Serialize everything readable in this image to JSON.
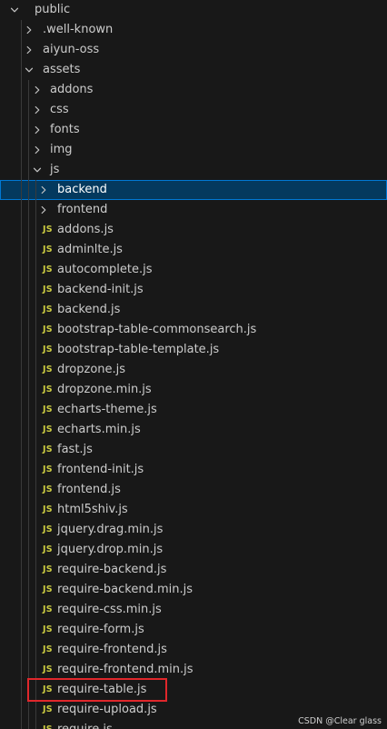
{
  "tree": [
    {
      "label": "public",
      "type": "folder",
      "depth": 0,
      "expanded": true
    },
    {
      "label": ".well-known",
      "type": "folder",
      "depth": 1,
      "expanded": false
    },
    {
      "label": "aiyun-oss",
      "type": "folder",
      "depth": 1,
      "expanded": false
    },
    {
      "label": "assets",
      "type": "folder",
      "depth": 1,
      "expanded": true
    },
    {
      "label": "addons",
      "type": "folder",
      "depth": 2,
      "expanded": false
    },
    {
      "label": "css",
      "type": "folder",
      "depth": 2,
      "expanded": false
    },
    {
      "label": "fonts",
      "type": "folder",
      "depth": 2,
      "expanded": false
    },
    {
      "label": "img",
      "type": "folder",
      "depth": 2,
      "expanded": false
    },
    {
      "label": "js",
      "type": "folder",
      "depth": 2,
      "expanded": true
    },
    {
      "label": "backend",
      "type": "folder",
      "depth": 3,
      "expanded": false,
      "selected": true
    },
    {
      "label": "frontend",
      "type": "folder",
      "depth": 3,
      "expanded": false
    },
    {
      "label": "addons.js",
      "type": "js",
      "depth": 3
    },
    {
      "label": "adminlte.js",
      "type": "js",
      "depth": 3
    },
    {
      "label": "autocomplete.js",
      "type": "js",
      "depth": 3
    },
    {
      "label": "backend-init.js",
      "type": "js",
      "depth": 3
    },
    {
      "label": "backend.js",
      "type": "js",
      "depth": 3
    },
    {
      "label": "bootstrap-table-commonsearch.js",
      "type": "js",
      "depth": 3
    },
    {
      "label": "bootstrap-table-template.js",
      "type": "js",
      "depth": 3
    },
    {
      "label": "dropzone.js",
      "type": "js",
      "depth": 3
    },
    {
      "label": "dropzone.min.js",
      "type": "js",
      "depth": 3
    },
    {
      "label": "echarts-theme.js",
      "type": "js",
      "depth": 3
    },
    {
      "label": "echarts.min.js",
      "type": "js",
      "depth": 3
    },
    {
      "label": "fast.js",
      "type": "js",
      "depth": 3
    },
    {
      "label": "frontend-init.js",
      "type": "js",
      "depth": 3
    },
    {
      "label": "frontend.js",
      "type": "js",
      "depth": 3
    },
    {
      "label": "html5shiv.js",
      "type": "js",
      "depth": 3
    },
    {
      "label": "jquery.drag.min.js",
      "type": "js",
      "depth": 3
    },
    {
      "label": "jquery.drop.min.js",
      "type": "js",
      "depth": 3
    },
    {
      "label": "require-backend.js",
      "type": "js",
      "depth": 3
    },
    {
      "label": "require-backend.min.js",
      "type": "js",
      "depth": 3
    },
    {
      "label": "require-css.min.js",
      "type": "js",
      "depth": 3
    },
    {
      "label": "require-form.js",
      "type": "js",
      "depth": 3
    },
    {
      "label": "require-frontend.js",
      "type": "js",
      "depth": 3
    },
    {
      "label": "require-frontend.min.js",
      "type": "js",
      "depth": 3
    },
    {
      "label": "require-table.js",
      "type": "js",
      "depth": 3,
      "highlighted": true
    },
    {
      "label": "require-upload.js",
      "type": "js",
      "depth": 3
    },
    {
      "label": "require.js",
      "type": "js",
      "depth": 3
    }
  ],
  "file_badge": "JS",
  "icons": {
    "expanded": "chevron-down-icon",
    "collapsed": "chevron-right-icon",
    "file": "js-file-icon"
  },
  "colors": {
    "background": "#181818",
    "text": "#cccccc",
    "selected_bg": "#04395e",
    "selected_border": "#0078d4",
    "js_badge": "#cbcb41",
    "highlight_box": "#e0272b"
  },
  "watermark": "CSDN @Clear glass"
}
